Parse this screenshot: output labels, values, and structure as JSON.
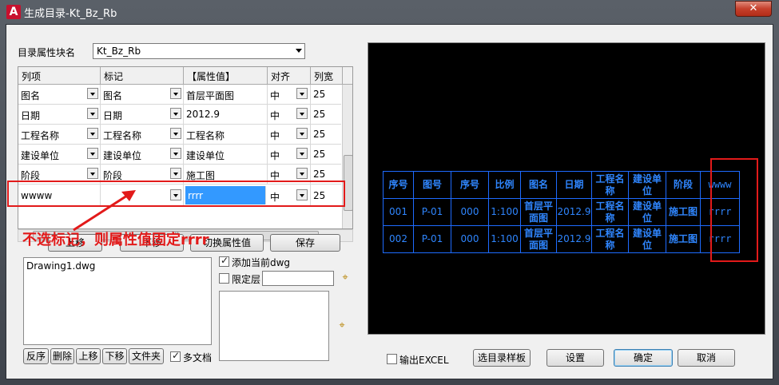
{
  "window": {
    "title": "生成目录-Kt_Bz_Rb",
    "app_icon": "A",
    "close_glyph": "✕"
  },
  "block": {
    "label": "目录属性块名",
    "value": "Kt_Bz_Rb"
  },
  "grid": {
    "headers": [
      "列项",
      "标记",
      "【属性值】",
      "对齐",
      "列宽"
    ],
    "rows": [
      {
        "col": "图名",
        "mark": "图名",
        "value": "首层平面图",
        "align": "中",
        "width": "25"
      },
      {
        "col": "日期",
        "mark": "日期",
        "value": "2012.9",
        "align": "中",
        "width": "25"
      },
      {
        "col": "工程名称",
        "mark": "工程名称",
        "value": "工程名称",
        "align": "中",
        "width": "25"
      },
      {
        "col": "建设单位",
        "mark": "建设单位",
        "value": "建设单位",
        "align": "中",
        "width": "25"
      },
      {
        "col": "阶段",
        "mark": "阶段",
        "value": "施工图",
        "align": "中",
        "width": "25"
      },
      {
        "col": "wwww",
        "mark": "",
        "value": "rrrr",
        "align": "中",
        "width": "25"
      }
    ],
    "hscroll_grip": "III"
  },
  "buttons": {
    "move_up": "上移",
    "move_down": "下移",
    "switch_attr": "切换属性值",
    "save": "保存",
    "export_excel": "输出EXCEL",
    "select_template": "选目录样板",
    "settings": "设置",
    "ok": "确定",
    "cancel": "取消"
  },
  "files": {
    "items": [
      "Drawing1.dwg"
    ],
    "buttons": [
      "反序",
      "删除",
      "上移",
      "下移",
      "文件夹"
    ],
    "multi_doc_label": "多文档",
    "multi_doc_checked": true
  },
  "options": {
    "add_current_dwg_label": "添加当前dwg",
    "add_current_dwg_checked": true,
    "limit_layer_label": "限定层",
    "limit_layer_checked": false,
    "limit_layer_value": ""
  },
  "export_excel_checked": false,
  "preview": {
    "headers": [
      "序号",
      "图号",
      "序号",
      "比例",
      "图名",
      "日期",
      "工程名称",
      "建设单位",
      "阶段",
      "wwww"
    ],
    "rows": [
      [
        "001",
        "P-01",
        "000",
        "1:100",
        "首层平面图",
        "2012.9",
        "工程名称",
        "建设单位",
        "施工图",
        "rrrr"
      ],
      [
        "002",
        "P-01",
        "000",
        "1:100",
        "首层平面图",
        "2012.9",
        "工程名称",
        "建设单位",
        "施工图",
        "rrrr"
      ]
    ],
    "line_color": "#1e6bff",
    "text_color": "#2f86ff"
  },
  "annotation": {
    "text": "不选标记，则属性值固定rrrr",
    "color": "#e21a1a"
  }
}
